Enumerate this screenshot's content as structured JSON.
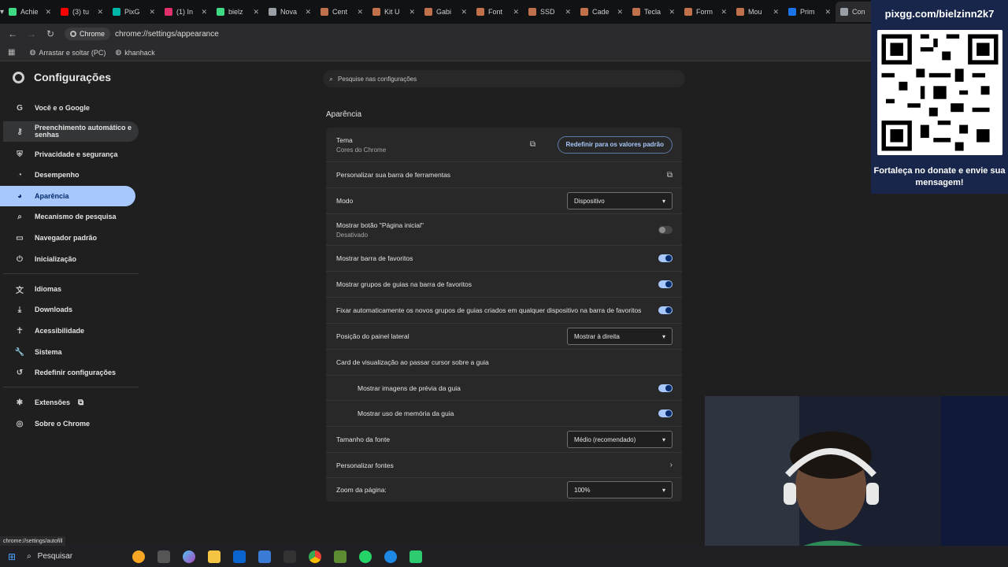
{
  "tabs": [
    {
      "title": "Achie",
      "color": "#3ddc84"
    },
    {
      "title": "(3) tu",
      "color": "#ff0000"
    },
    {
      "title": "PixG",
      "color": "#00b8a9"
    },
    {
      "title": "(1) In",
      "color": "#e1306c"
    },
    {
      "title": "bielz",
      "color": "#3ddc84"
    },
    {
      "title": "Nova",
      "color": "#9aa0a6"
    },
    {
      "title": "Cent",
      "color": "#c0704a"
    },
    {
      "title": "Kit U",
      "color": "#c0704a"
    },
    {
      "title": "Gabi",
      "color": "#c0704a"
    },
    {
      "title": "Font",
      "color": "#c0704a"
    },
    {
      "title": "SSD",
      "color": "#c0704a"
    },
    {
      "title": "Cade",
      "color": "#c0704a"
    },
    {
      "title": "Tecla",
      "color": "#c0704a"
    },
    {
      "title": "Form",
      "color": "#c0704a"
    },
    {
      "title": "Mou",
      "color": "#c0704a"
    },
    {
      "title": "Prim",
      "color": "#1a73e8"
    },
    {
      "title": "Con",
      "color": "#9aa0a6",
      "active": true
    }
  ],
  "toolbar": {
    "chip_label": "Chrome",
    "url": "chrome://settings/appearance"
  },
  "bookmarks": [
    {
      "label": "Arrastar e soltar (PC)"
    },
    {
      "label": "khanhack"
    }
  ],
  "settings": {
    "title": "Configurações",
    "search_placeholder": "Pesquise nas configurações",
    "nav": [
      {
        "label": "Você e o Google",
        "icon": "google-icon"
      },
      {
        "label": "Preenchimento automático e senhas",
        "icon": "key-icon"
      },
      {
        "label": "Privacidade e segurança",
        "icon": "shield-icon"
      },
      {
        "label": "Desempenho",
        "icon": "speedometer-icon"
      },
      {
        "label": "Aparência",
        "icon": "palette-icon",
        "active": true
      },
      {
        "label": "Mecanismo de pesquisa",
        "icon": "search-icon"
      },
      {
        "label": "Navegador padrão",
        "icon": "browser-icon"
      },
      {
        "label": "Inicialização",
        "icon": "power-icon"
      },
      {
        "label": "Idiomas",
        "icon": "translate-icon"
      },
      {
        "label": "Downloads",
        "icon": "download-icon"
      },
      {
        "label": "Acessibilidade",
        "icon": "accessibility-icon"
      },
      {
        "label": "Sistema",
        "icon": "wrench-icon"
      },
      {
        "label": "Redefinir configurações",
        "icon": "reset-icon"
      },
      {
        "label": "Extensões",
        "icon": "puzzle-icon"
      },
      {
        "label": "Sobre o Chrome",
        "icon": "chrome-icon"
      }
    ],
    "section_title": "Aparência",
    "theme": {
      "label": "Tema",
      "sub": "Cores do Chrome",
      "reset_label": "Redefinir para os valores padrão"
    },
    "customize_toolbar": "Personalizar sua barra de ferramentas",
    "mode": {
      "label": "Modo",
      "value": "Dispositivo"
    },
    "home_button": {
      "label": "Mostrar botão \"Página inicial\"",
      "sub": "Desativado",
      "enabled": false
    },
    "show_bookmarks": {
      "label": "Mostrar barra de favoritos",
      "enabled": true
    },
    "show_tab_groups": {
      "label": "Mostrar grupos de guias na barra de favoritos",
      "enabled": true
    },
    "pin_tab_groups": {
      "label": "Fixar automaticamente os novos grupos de guias criados em qualquer dispositivo na barra de favoritos",
      "enabled": true
    },
    "side_panel": {
      "label": "Posição do painel lateral",
      "value": "Mostrar à direita"
    },
    "hover_card": {
      "label": "Card de visualização ao passar cursor sobre a guia"
    },
    "hover_preview": {
      "label": "Mostrar imagens de prévia da guia",
      "enabled": true
    },
    "hover_memory": {
      "label": "Mostrar uso de memória da guia",
      "enabled": true
    },
    "font_size": {
      "label": "Tamanho da fonte",
      "value": "Médio (recomendado)"
    },
    "custom_fonts": {
      "label": "Personalizar fontes"
    },
    "zoom": {
      "label": "Zoom da página:",
      "value": "100%"
    }
  },
  "overlay": {
    "url": "pixgg.com/bielzinn2k7",
    "message": "Fortaleça no donate e envie sua mensagem!"
  },
  "status_url": "chrome://settings/autofill",
  "taskbar": {
    "search_label": "Pesquisar"
  }
}
